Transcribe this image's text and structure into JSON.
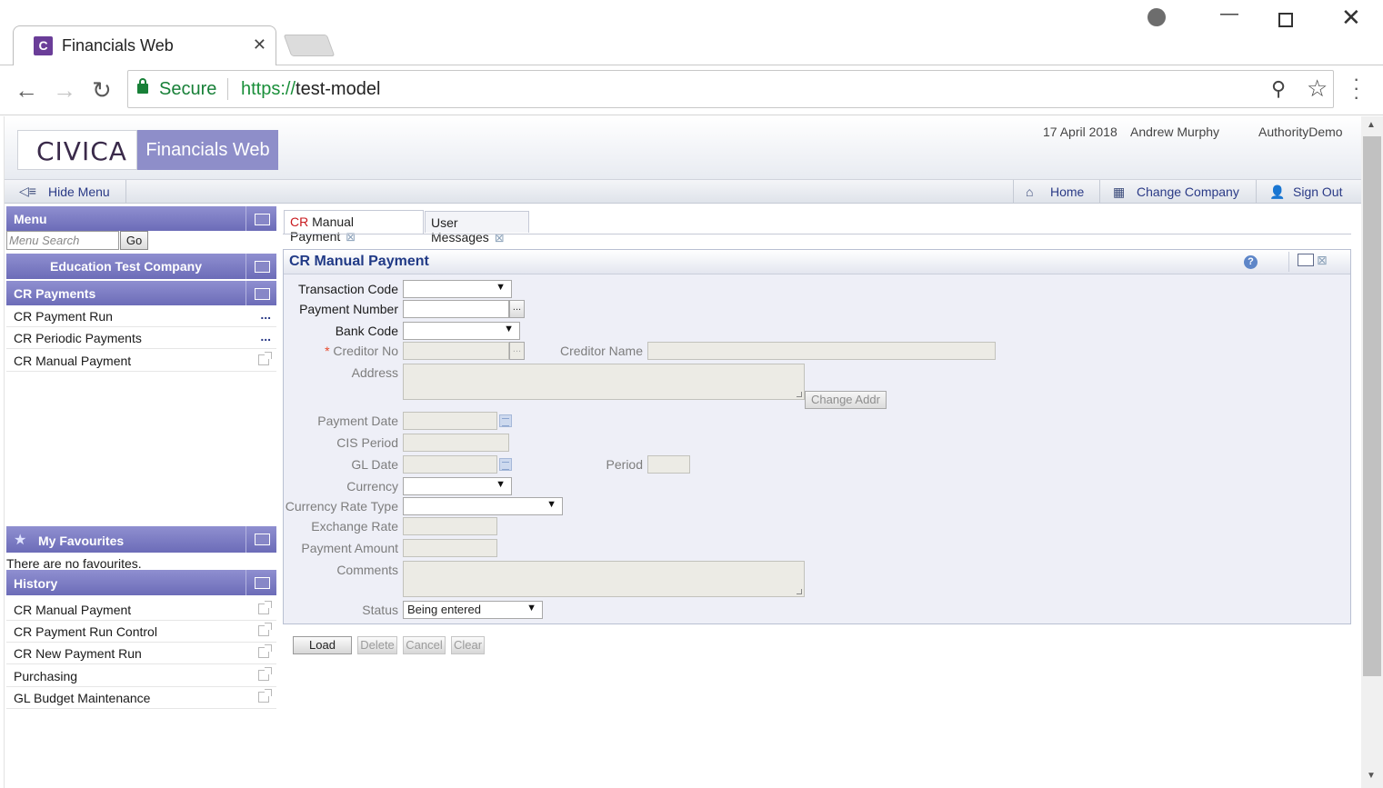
{
  "browser": {
    "tab_title": "Financials Web",
    "tab_favicon": "C",
    "secure_label": "Secure",
    "url_scheme": "https://",
    "url_host": "test-model"
  },
  "header": {
    "logo": "CIVICA",
    "product": "Financials Web",
    "date": "17 April 2018",
    "user": "Andrew Murphy",
    "company": "AuthorityDemo"
  },
  "toolbar": {
    "hide_menu": "Hide Menu",
    "home": "Home",
    "change_company": "Change Company",
    "sign_out": "Sign Out"
  },
  "sidebar": {
    "menu_title": "Menu",
    "search_placeholder": "Menu Search",
    "go_label": "Go",
    "company_title": "Education Test Company",
    "section_title": "CR Payments",
    "items": [
      {
        "label": "CR Payment Run",
        "marker": "..."
      },
      {
        "label": "CR Periodic Payments",
        "marker": "..."
      },
      {
        "label": "CR Manual Payment",
        "marker": "external"
      }
    ],
    "favourites_title": "My Favourites",
    "favourites_empty": "There are no favourites.",
    "history_title": "History",
    "history": [
      "CR Manual Payment",
      "CR Payment Run Control",
      "CR New Payment Run",
      "Purchasing",
      "GL Budget Maintenance"
    ]
  },
  "content_tabs": [
    {
      "prefix": "CR",
      "label": " Manual Payment",
      "active": true
    },
    {
      "prefix": "",
      "label": "User Messages",
      "active": false
    }
  ],
  "form": {
    "title": "CR Manual Payment",
    "help_icon": "?",
    "labels": {
      "transaction_code": "Transaction Code",
      "payment_number": "Payment Number",
      "bank_code": "Bank Code",
      "creditor_no": "Creditor No",
      "creditor_name": "Creditor Name",
      "address": "Address",
      "change_addr": "Change Addr",
      "payment_date": "Payment Date",
      "cis_period": "CIS Period",
      "gl_date": "GL Date",
      "period": "Period",
      "currency": "Currency",
      "currency_rate_type": "Currency Rate Type",
      "exchange_rate": "Exchange Rate",
      "payment_amount": "Payment Amount",
      "comments": "Comments",
      "status": "Status"
    },
    "required_marker": "*",
    "values": {
      "status": "Being entered"
    },
    "actions": {
      "load": "Load",
      "delete": "Delete",
      "cancel": "Cancel",
      "clear": "Clear"
    }
  }
}
